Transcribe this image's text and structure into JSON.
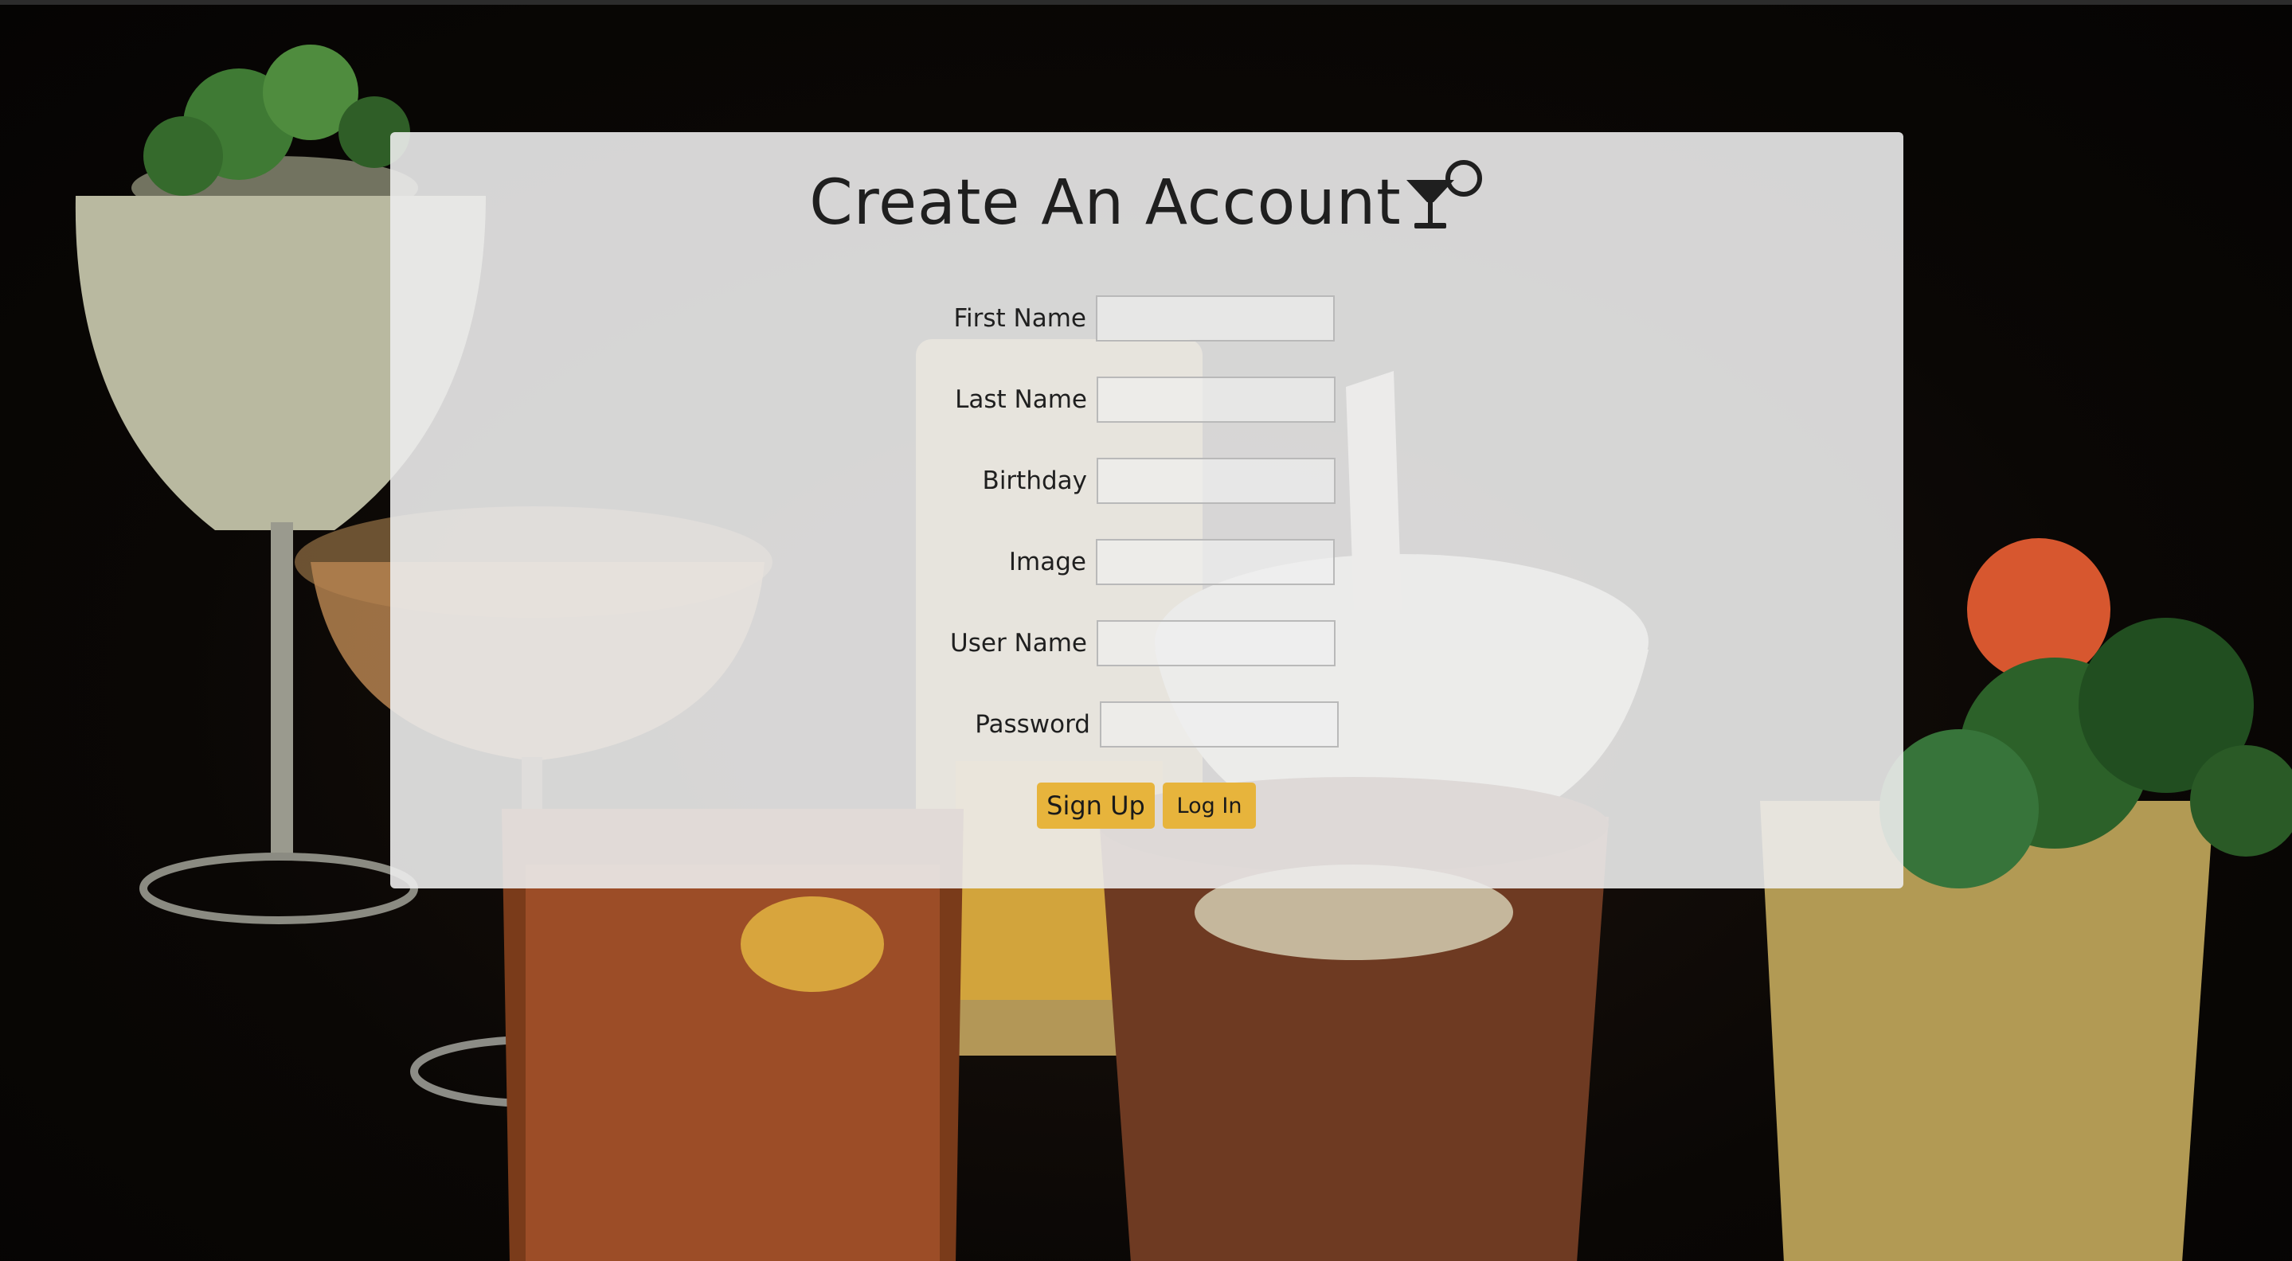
{
  "page": {
    "title": "Create An Account",
    "title_icon": "cocktail-glass-icon"
  },
  "form": {
    "fields": [
      {
        "label": "First Name",
        "value": ""
      },
      {
        "label": "Last Name",
        "value": ""
      },
      {
        "label": "Birthday",
        "value": ""
      },
      {
        "label": "Image",
        "value": ""
      },
      {
        "label": "User Name",
        "value": ""
      },
      {
        "label": "Password",
        "value": ""
      }
    ],
    "signup_label": "Sign Up",
    "login_label": "Log In"
  },
  "colors": {
    "button": "#e7b43c",
    "card": "#ececec",
    "text": "#1f1f1f"
  },
  "background": "cocktail-glasses-photo"
}
